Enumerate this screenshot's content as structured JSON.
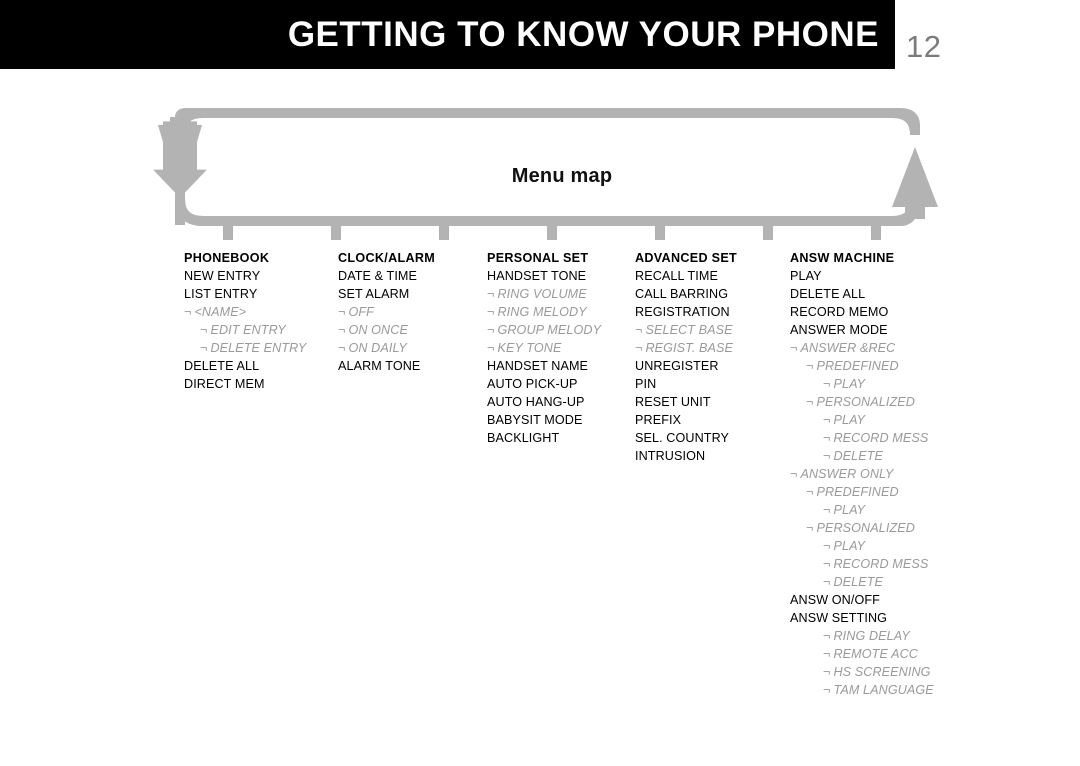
{
  "header": {
    "title": "GETTING TO KNOW YOUR PHONE",
    "page_number": "12",
    "bar_color": "#000000",
    "title_color": "#ffffff",
    "page_number_color": "#7b7b7b"
  },
  "menu_map": {
    "title": "Menu map",
    "outline_color": "#b3b3b3",
    "left_arrow_icon": "arrow-down-icon",
    "right_arrow_icon": "arrow-up-icon",
    "stem_count": 7
  },
  "colors": {
    "main_text": "#000000",
    "sub_text": "#9a9a9a",
    "accent_gray": "#b3b3b3"
  },
  "columns": [
    {
      "header": "PHONEBOOK",
      "items": [
        {
          "label": "NEW ENTRY",
          "level": 0
        },
        {
          "label": "LIST ENTRY",
          "level": 0
        },
        {
          "label": "<NAME>",
          "level": 1
        },
        {
          "label": "EDIT ENTRY",
          "level": 2
        },
        {
          "label": "DELETE ENTRY",
          "level": 2
        },
        {
          "label": "DELETE ALL",
          "level": 0
        },
        {
          "label": "DIRECT MEM",
          "level": 0
        }
      ]
    },
    {
      "header": "CLOCK/ALARM",
      "items": [
        {
          "label": "DATE & TIME",
          "level": 0
        },
        {
          "label": "SET ALARM",
          "level": 0
        },
        {
          "label": "OFF",
          "level": 1
        },
        {
          "label": "ON ONCE",
          "level": 1
        },
        {
          "label": "ON DAILY",
          "level": 1
        },
        {
          "label": "ALARM TONE",
          "level": 0
        }
      ]
    },
    {
      "header": "PERSONAL SET",
      "items": [
        {
          "label": "HANDSET TONE",
          "level": 0
        },
        {
          "label": "RING VOLUME",
          "level": 1
        },
        {
          "label": "RING MELODY",
          "level": 1
        },
        {
          "label": "GROUP MELODY",
          "level": 1
        },
        {
          "label": "KEY TONE",
          "level": 1
        },
        {
          "label": "HANDSET NAME",
          "level": 0
        },
        {
          "label": "AUTO PICK-UP",
          "level": 0
        },
        {
          "label": "AUTO HANG-UP",
          "level": 0
        },
        {
          "label": "BABYSIT MODE",
          "level": 0
        },
        {
          "label": "BACKLIGHT",
          "level": 0
        }
      ]
    },
    {
      "header": "ADVANCED SET",
      "items": [
        {
          "label": "RECALL TIME",
          "level": 0
        },
        {
          "label": "CALL BARRING",
          "level": 0
        },
        {
          "label": "REGISTRATION",
          "level": 0
        },
        {
          "label": "SELECT BASE",
          "level": 1
        },
        {
          "label": "REGIST. BASE",
          "level": 1
        },
        {
          "label": "UNREGISTER",
          "level": 0
        },
        {
          "label": "PIN",
          "level": 0
        },
        {
          "label": "RESET UNIT",
          "level": 0
        },
        {
          "label": "PREFIX",
          "level": 0
        },
        {
          "label": "SEL. COUNTRY",
          "level": 0
        },
        {
          "label": "INTRUSION",
          "level": 0
        }
      ]
    },
    {
      "header": "ANSW MACHINE",
      "items": [
        {
          "label": "PLAY",
          "level": 0
        },
        {
          "label": "DELETE ALL",
          "level": 0
        },
        {
          "label": "RECORD MEMO",
          "level": 0
        },
        {
          "label": "ANSWER MODE",
          "level": 0
        },
        {
          "label": "ANSWER &REC",
          "level": 1
        },
        {
          "label": "PREDEFINED",
          "level": 2
        },
        {
          "label": "PLAY",
          "level": 3
        },
        {
          "label": "PERSONALIZED",
          "level": 2
        },
        {
          "label": "PLAY",
          "level": 3
        },
        {
          "label": "RECORD MESS",
          "level": 3
        },
        {
          "label": "DELETE",
          "level": 3
        },
        {
          "label": "ANSWER ONLY",
          "level": 1
        },
        {
          "label": "PREDEFINED",
          "level": 2
        },
        {
          "label": "PLAY",
          "level": 3
        },
        {
          "label": "PERSONALIZED",
          "level": 2
        },
        {
          "label": "PLAY",
          "level": 3
        },
        {
          "label": "RECORD MESS",
          "level": 3
        },
        {
          "label": "DELETE",
          "level": 3
        },
        {
          "label": "ANSW ON/OFF",
          "level": 0
        },
        {
          "label": "ANSW SETTING",
          "level": 0
        },
        {
          "label": "RING DELAY",
          "level": 3
        },
        {
          "label": "REMOTE ACC",
          "level": 3
        },
        {
          "label": "HS SCREENING",
          "level": 3
        },
        {
          "label": "TAM LANGUAGE",
          "level": 3
        }
      ]
    }
  ],
  "sub_arrow_glyph": "¬"
}
